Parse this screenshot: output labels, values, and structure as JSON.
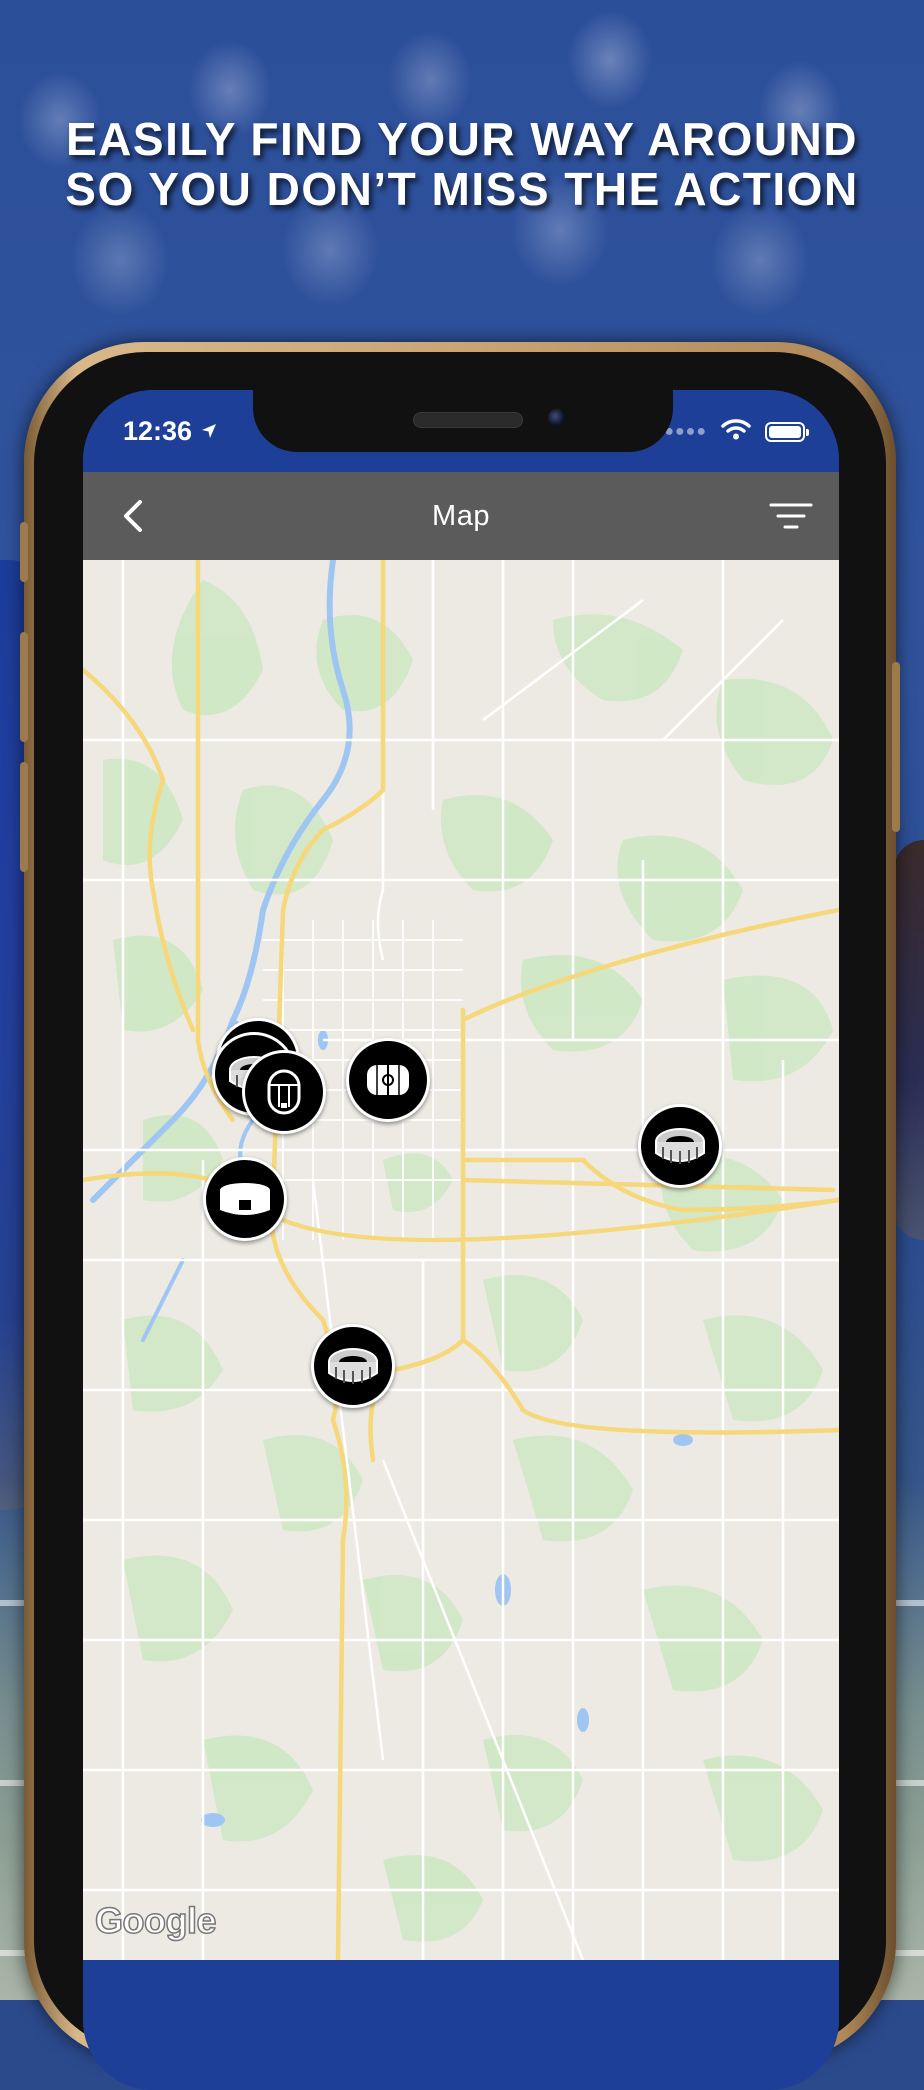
{
  "headline": {
    "line1": "EASILY FIND YOUR WAY AROUND",
    "line2": "SO YOU DON’T MISS THE ACTION"
  },
  "status_bar": {
    "time": "12:36",
    "location_icon": "location-arrow-icon",
    "signal_icon": "signal-dots-icon",
    "wifi_icon": "wifi-icon",
    "battery_icon": "battery-icon"
  },
  "nav": {
    "title": "Map",
    "back_icon": "chevron-left-icon",
    "filter_icon": "filter-icon"
  },
  "map": {
    "attribution": "Google",
    "markers": [
      {
        "name": "stadium-marker-cluster",
        "icon": "stadium-icon"
      },
      {
        "name": "arena-marker",
        "icon": "arena-icon"
      },
      {
        "name": "hockey-rink-marker",
        "icon": "rink-icon"
      },
      {
        "name": "ice-rink-marker",
        "icon": "ice-rink-icon"
      },
      {
        "name": "stadium-marker-east",
        "icon": "stadium-icon"
      },
      {
        "name": "stadium-marker-south",
        "icon": "stadium-icon"
      }
    ]
  },
  "colors": {
    "brand_blue": "#1e3f98",
    "nav_gray": "#5b5b5b",
    "map_land": "#eceae3",
    "map_park": "#cfe8c4",
    "map_highway": "#f6d77a",
    "map_water": "#9fc6f2"
  }
}
